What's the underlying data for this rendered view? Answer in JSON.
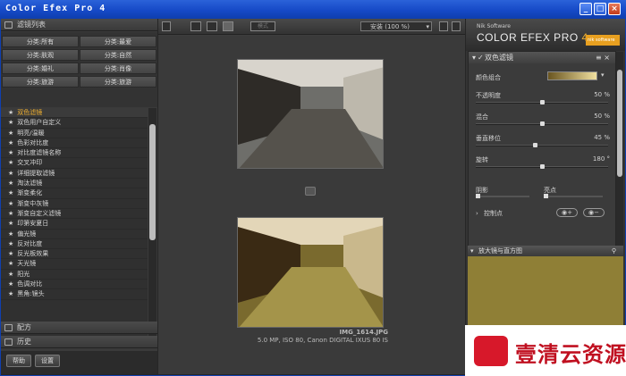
{
  "window": {
    "title": "Color Efex Pro 4",
    "min": "_",
    "max": "□",
    "close": "×"
  },
  "left": {
    "filter_list_header": "滤镜列表",
    "categories": [
      "分类:所有",
      "分类:最爱",
      "分类:肤观",
      "分类:自然",
      "分类:婚礼",
      "分类:肖像",
      "分类:旅游",
      "分类:旅游"
    ],
    "filters": [
      "双色滤镜",
      "双色用户自定义",
      "明亮/温暖",
      "色彩对比度",
      "对比度滤镜名称",
      "交叉冲印",
      "详细提取滤镜",
      "淘汰滤镜",
      "渐变柔化",
      "渐变中灰镜",
      "渐变自定义滤镜",
      "印第安夏日",
      "偏光镜",
      "反对比度",
      "反光板效果",
      "天光镜",
      "阳光",
      "色调对比",
      "黑角:镜头"
    ],
    "active_index": 0,
    "presets_label": "配方",
    "history_label": "历史",
    "help_label": "帮助",
    "settings_label": "设置"
  },
  "center": {
    "zoom_label": "安装 (100 %)",
    "mode_label": "模式",
    "filename": "IMG_1614.JPG",
    "exif": "5.0 MP, ISO 80, Canon DIGITAL IXUS 80 IS"
  },
  "right": {
    "brand_small": "Nik Software",
    "brand_name": "COLOR EFEX PRO",
    "brand_ver": "4",
    "logo_text": "nik software",
    "panel_title": "双色滤镜",
    "color_group_label": "颜色组合",
    "params": [
      {
        "label": "不透明度",
        "value": "50 %"
      },
      {
        "label": "混合",
        "value": "50 %"
      },
      {
        "label": "垂直移位",
        "value": "45 %"
      },
      {
        "label": "旋转",
        "value": "180 °"
      }
    ],
    "param_levels": [
      0.5,
      0.5,
      0.45,
      0.5
    ],
    "shadow_label": "阴影",
    "highlight_label": "亮点",
    "control_points_label": "控制点",
    "loupe_label": "放大镜与直方图"
  },
  "watermark": {
    "text": "壹清云资源"
  },
  "colors": {
    "accent": "#f0b030",
    "title_blue": "#1549c6",
    "watermark_red": "#c01020"
  }
}
